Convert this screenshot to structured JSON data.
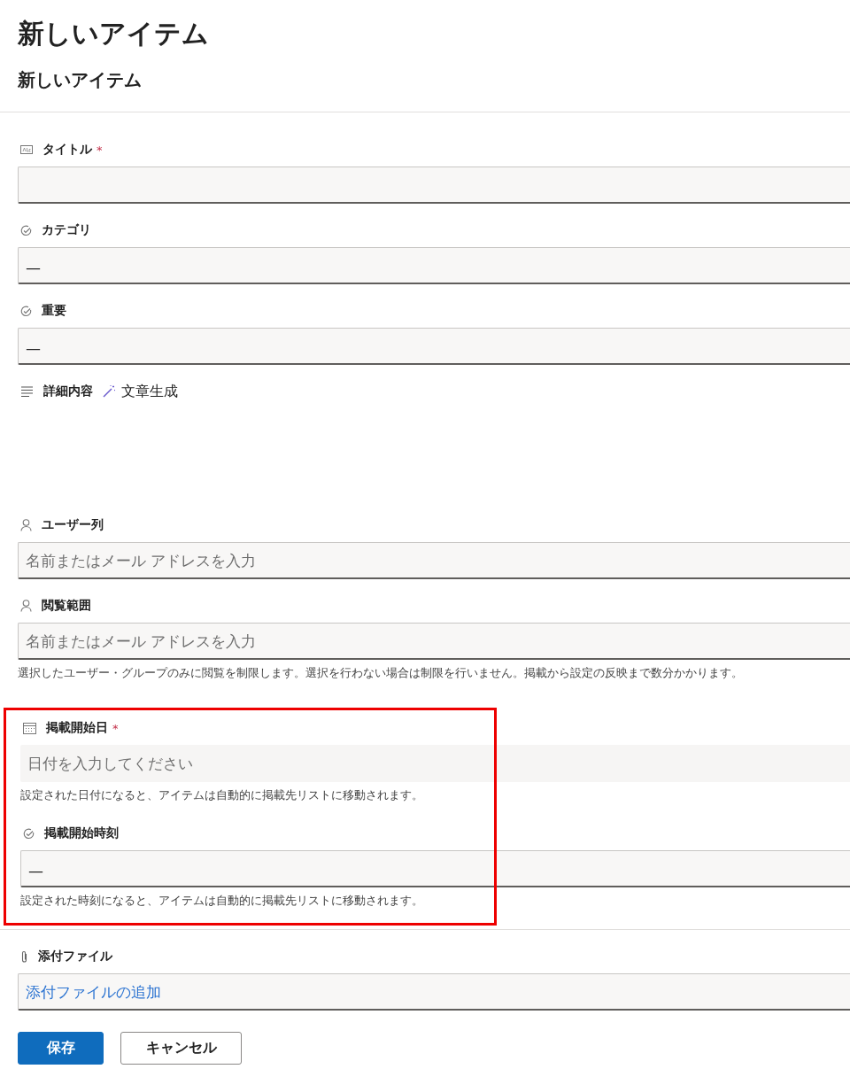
{
  "page_title": "新しいアイテム",
  "form_title": "新しいアイテム",
  "sections": [
    {
      "highlighted": false,
      "fields": [
        {
          "kind": "text",
          "label": "タイトル",
          "required_mark": "*"
        },
        {
          "kind": "choice",
          "label": "カテゴリ",
          "value": "—"
        },
        {
          "kind": "choice",
          "label": "重要",
          "value": "—"
        },
        {
          "kind": "multiline",
          "label": "詳細内容",
          "action": "文章生成"
        },
        {
          "kind": "person",
          "label": "ユーザー列",
          "placeholder": "名前またはメール アドレスを入力"
        },
        {
          "kind": "person",
          "label": "閲覧範囲",
          "placeholder": "名前またはメール アドレスを入力",
          "help": "選択したユーザー・グループのみに閲覧を制限します。選択を行わない場合は制限を行いません。掲載から設定の反映まで数分かかります。"
        }
      ]
    },
    {
      "highlighted": true,
      "fields": [
        {
          "kind": "date",
          "label": "掲載開始日",
          "required_mark": "*",
          "placeholder": "日付を入力してください",
          "help": "設定された日付になると、アイテムは自動的に掲載先リストに移動されます。"
        },
        {
          "kind": "choice",
          "label": "掲載開始時刻",
          "value": "—",
          "help": "設定された時刻になると、アイテムは自動的に掲載先リストに移動されます。"
        }
      ]
    },
    {
      "highlighted": false,
      "fields": [
        {
          "kind": "attachment",
          "label": "添付ファイル",
          "link": "添付ファイルの追加"
        }
      ]
    }
  ],
  "buttons": [
    {
      "label": "保存",
      "primary": true
    },
    {
      "label": "キャンセル",
      "primary": false
    }
  ]
}
